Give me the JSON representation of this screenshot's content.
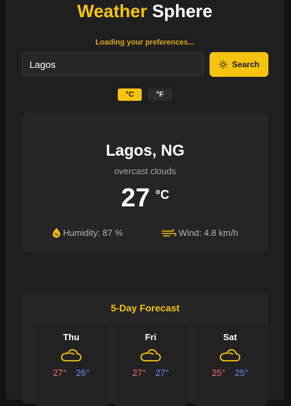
{
  "header": {
    "title_accent": "Weather",
    "title_rest": "Sphere",
    "loading_text": "Loading your preferences..."
  },
  "search": {
    "value": "Lagos",
    "placeholder": "",
    "button_label": "Search"
  },
  "units": {
    "celsius_label": "°C",
    "fahrenheit_label": "°F",
    "selected": "°C"
  },
  "current": {
    "city": "Lagos, NG",
    "description": "overcast clouds",
    "temperature": "27",
    "unit": "°C",
    "humidity": "Humidity: 87 %",
    "wind": "Wind: 4.8 km/h"
  },
  "forecast": {
    "title": "5-Day Forecast",
    "days": [
      {
        "day": "Thu",
        "high": "27°",
        "low": "26°",
        "icon": "cloud-icon"
      },
      {
        "day": "Fri",
        "high": "27°",
        "low": "27°",
        "icon": "cloud-icon"
      },
      {
        "day": "Sat",
        "high": "25°",
        "low": "25°",
        "icon": "cloud-icon"
      }
    ]
  },
  "colors": {
    "accent": "#f6c410",
    "background": "#1f1f1f",
    "card": "#252525",
    "high_temp": "#ff6b6b",
    "low_temp": "#6b8cff"
  }
}
